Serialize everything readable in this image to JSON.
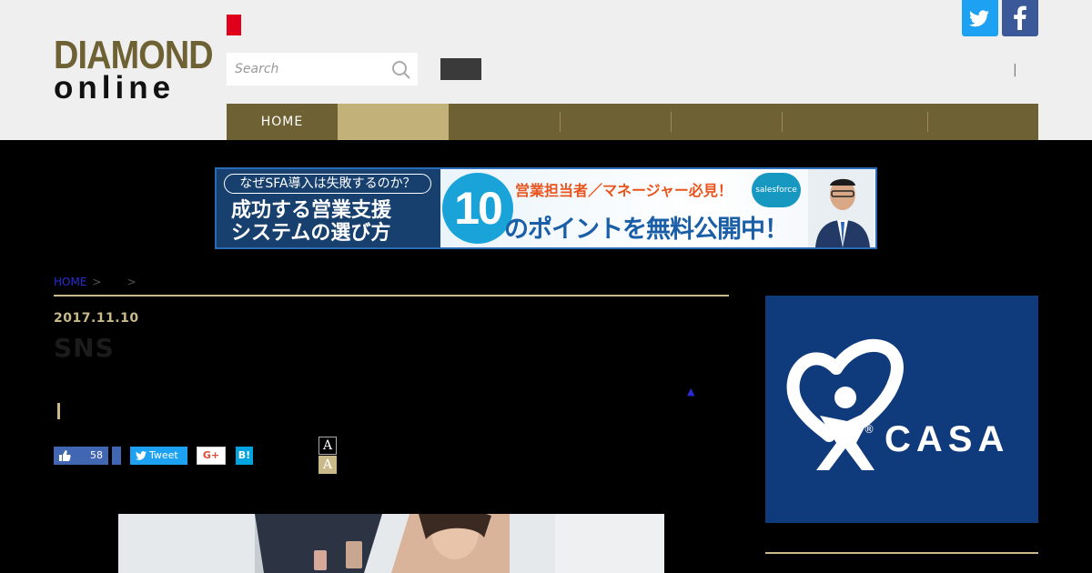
{
  "header": {
    "logo": {
      "line1": "DIAMOND",
      "line2": "online"
    },
    "search": {
      "placeholder": "Search"
    },
    "separator": "|",
    "social": {
      "twitter_icon": "twitter-bird-icon",
      "facebook_icon": "facebook-f-icon"
    }
  },
  "nav": {
    "items": [
      {
        "label": "HOME"
      },
      {
        "label": "",
        "active": true
      },
      {
        "label": ""
      },
      {
        "label": ""
      },
      {
        "label": ""
      },
      {
        "label": ""
      },
      {
        "label": ""
      }
    ]
  },
  "banner": {
    "pill": "なぜSFA導入は失敗するのか？",
    "line1": "成功する営業支援",
    "line2": "システムの選び方",
    "number": "10",
    "top_copy": "営業担当者／マネージャー必見！",
    "main_copy": "のポイントを無料公開中！",
    "sponsor": "salesforce"
  },
  "breadcrumb": {
    "home": "HOME",
    "arrow1": ">",
    "arrow2": ">"
  },
  "article": {
    "date": "2017.11.10",
    "title": "SNS",
    "up_arrow": "▲"
  },
  "share": {
    "like_count": "58",
    "tweet_label": "Tweet",
    "gplus_label": "G+",
    "hatena_label": "B!"
  },
  "font_size": {
    "large": "A",
    "small": "A"
  },
  "side_ad": {
    "brand": "CASA",
    "reg": "®"
  },
  "colors": {
    "brand_gold_dark": "#6e6234",
    "brand_gold_light": "#c3b17a",
    "twitter": "#1da1f2",
    "facebook": "#3b5998",
    "accent_red": "#e0001b"
  }
}
